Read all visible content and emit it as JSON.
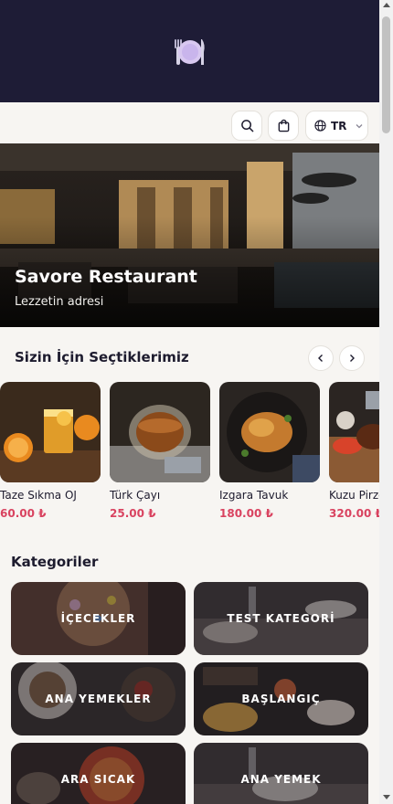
{
  "header": {
    "logo_icon": "restaurant-plate-icon"
  },
  "toolbar": {
    "search_icon": "search-icon",
    "cart_icon": "shopping-bag-icon",
    "language_icon": "globe-icon",
    "language": "TR",
    "chevron_icon": "chevron-down-icon"
  },
  "hero": {
    "title": "Savore Restaurant",
    "subtitle": "Lezzetin adresi"
  },
  "picks": {
    "title": "Sizin İçin Seçtiklerimiz",
    "prev_icon": "chevron-left-icon",
    "next_icon": "chevron-right-icon",
    "items": [
      {
        "name": "Taze Sıkma OJ",
        "price": "60.00 ₺"
      },
      {
        "name": "Türk Çayı",
        "price": "25.00 ₺"
      },
      {
        "name": "Izgara Tavuk",
        "price": "180.00 ₺"
      },
      {
        "name": "Kuzu Pirzola",
        "price": "320.00 ₺"
      }
    ]
  },
  "categories": {
    "title": "Kategoriler",
    "items": [
      {
        "label": "İÇECEKLER"
      },
      {
        "label": "TEST KATEGORİ"
      },
      {
        "label": "ANA YEMEKLER"
      },
      {
        "label": "BAŞLANGIÇ"
      },
      {
        "label": "ARA SICAK"
      },
      {
        "label": "ANA YEMEK"
      }
    ]
  },
  "colors": {
    "header_bg": "#1e1c36",
    "price": "#d94360",
    "page_bg": "#f7f5f2"
  }
}
